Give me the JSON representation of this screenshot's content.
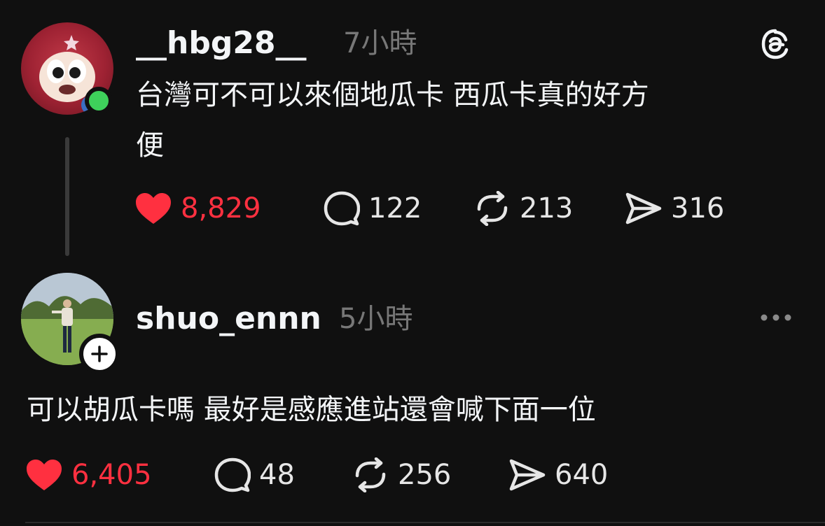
{
  "posts": [
    {
      "username": "__hbg28__",
      "time": "7小時",
      "text_line1": "台灣可不可以來個地瓜卡 西瓜卡真的好方",
      "text_line2": "便",
      "likes": "8,829",
      "replies": "122",
      "reposts": "213",
      "shares": "316",
      "liked": true,
      "avatar_online": true
    },
    {
      "username": "shuo_ennn",
      "time": "5小時",
      "text": "可以胡瓜卡嗎 最好是感應進站還會喊下面一位",
      "likes": "6,405",
      "replies": "48",
      "reposts": "256",
      "shares": "640",
      "liked": true
    }
  ],
  "icons": {
    "app_logo": "threads-logo-icon",
    "more": "more-icon",
    "like": "heart-icon",
    "reply": "comment-icon",
    "repost": "repost-icon",
    "share": "send-icon",
    "follow": "plus-icon"
  },
  "colors": {
    "background": "#101010",
    "liked": "#ff3040",
    "online": "#3ed15b",
    "muted": "#777777"
  }
}
